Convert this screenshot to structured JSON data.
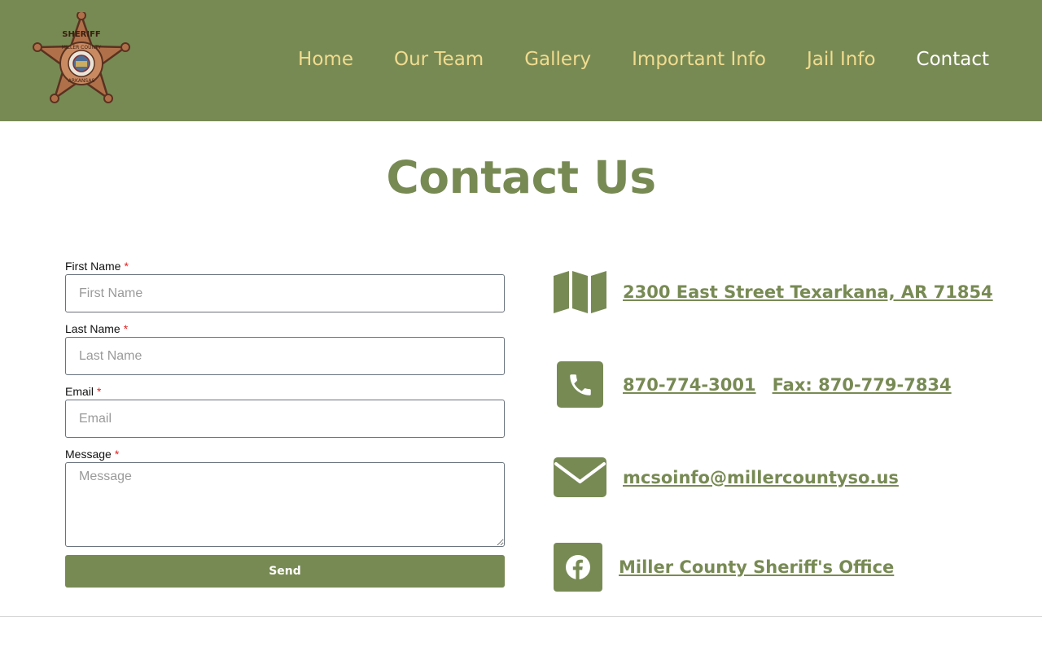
{
  "logo": {
    "top_text": "SHERIFF",
    "county_text": "MILLER COUNTY",
    "state_text": "ARKANSAS"
  },
  "nav": {
    "items": [
      {
        "label": "Home"
      },
      {
        "label": "Our Team"
      },
      {
        "label": "Gallery"
      },
      {
        "label": "Important Info"
      },
      {
        "label": "Jail Info"
      },
      {
        "label": "Contact"
      }
    ],
    "active": "Contact"
  },
  "page": {
    "title": "Contact Us"
  },
  "form": {
    "first_name": {
      "label": "First Name",
      "required": "*",
      "placeholder": "First Name",
      "value": ""
    },
    "last_name": {
      "label": "Last Name",
      "required": "*",
      "placeholder": "Last Name",
      "value": ""
    },
    "email": {
      "label": "Email",
      "required": "*",
      "placeholder": "Email",
      "value": ""
    },
    "message": {
      "label": "Message",
      "required": "*",
      "placeholder": "Message",
      "value": ""
    },
    "send_label": "Send"
  },
  "contact": {
    "address": "2300 East Street Texarkana, AR 71854",
    "phone": "870-774-3001",
    "fax": "Fax: 870-779-7834",
    "email": "mcsoinfo@millercountyso.us",
    "facebook": "Miller County Sheriff's Office"
  },
  "icons": {
    "address": "map-icon",
    "phone": "phone-icon",
    "email": "envelope-icon",
    "facebook": "facebook-icon"
  },
  "colors": {
    "brand_green": "#788a54",
    "nav_text": "#f1dc8f",
    "nav_active": "#ffffff",
    "required": "#dd2222"
  }
}
